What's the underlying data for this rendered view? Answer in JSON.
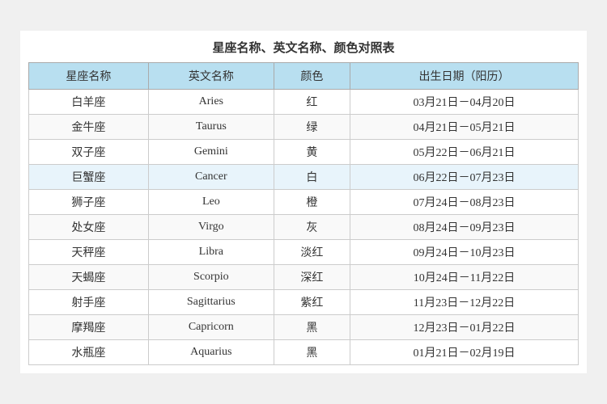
{
  "title": "星座名称、英文名称、颜色对照表",
  "table": {
    "headers": [
      "星座名称",
      "英文名称",
      "颜色",
      "出生日期（阳历）"
    ],
    "rows": [
      {
        "chinese": "白羊座",
        "english": "Aries",
        "color": "红",
        "date": "03月21日－04月20日",
        "highlight": false
      },
      {
        "chinese": "金牛座",
        "english": "Taurus",
        "color": "绿",
        "date": "04月21日－05月21日",
        "highlight": false
      },
      {
        "chinese": "双子座",
        "english": "Gemini",
        "color": "黄",
        "date": "05月22日－06月21日",
        "highlight": false
      },
      {
        "chinese": "巨蟹座",
        "english": "Cancer",
        "color": "白",
        "date": "06月22日－07月23日",
        "highlight": true
      },
      {
        "chinese": "狮子座",
        "english": "Leo",
        "color": "橙",
        "date": "07月24日－08月23日",
        "highlight": false
      },
      {
        "chinese": "处女座",
        "english": "Virgo",
        "color": "灰",
        "date": "08月24日－09月23日",
        "highlight": false
      },
      {
        "chinese": "天秤座",
        "english": "Libra",
        "color": "淡红",
        "date": "09月24日－10月23日",
        "highlight": false
      },
      {
        "chinese": "天蝎座",
        "english": "Scorpio",
        "color": "深红",
        "date": "10月24日－11月22日",
        "highlight": false
      },
      {
        "chinese": "射手座",
        "english": "Sagittarius",
        "color": "紫红",
        "date": "11月23日－12月22日",
        "highlight": false
      },
      {
        "chinese": "摩羯座",
        "english": "Capricorn",
        "color": "黑",
        "date": "12月23日－01月22日",
        "highlight": false
      },
      {
        "chinese": "水瓶座",
        "english": "Aquarius",
        "color": "黑",
        "date": "01月21日－02月19日",
        "highlight": false
      }
    ]
  }
}
